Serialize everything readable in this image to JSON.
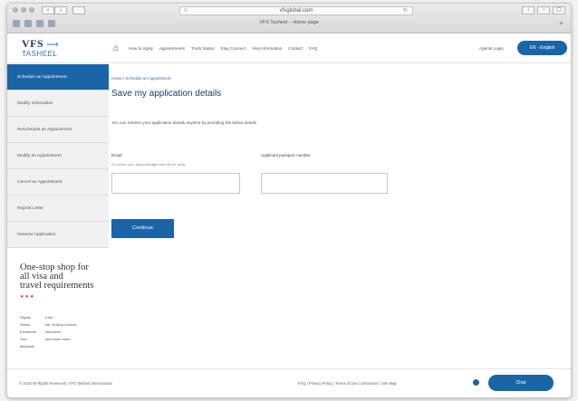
{
  "browser": {
    "url": "vfsglobal.com",
    "tab_title": "VFS Tasheel – Home page",
    "back_icon": "chevron-left-icon",
    "forward_icon": "chevron-right-icon"
  },
  "header": {
    "logo_vfs": "VFS",
    "logo_tasheel": "TASHEEL",
    "nav": [
      "How to Apply",
      "Appointments",
      "Track Status",
      "Stay Connect",
      "Visa Information",
      "Contact",
      "FAQ"
    ],
    "signin": "Agents Login",
    "language_button": "EN - English"
  },
  "sidebar": {
    "items": [
      {
        "label": "Schedule an Appointment",
        "active": true
      },
      {
        "label": "Modify Information",
        "active": false
      },
      {
        "label": "Reschedule an Appointment",
        "active": false
      },
      {
        "label": "Modify an Appointment",
        "active": false
      },
      {
        "label": "Cancel an Appointment",
        "active": false
      },
      {
        "label": "Reprint Letter",
        "active": false
      },
      {
        "label": "Resume Application",
        "active": false
      }
    ],
    "promo": {
      "slogan_lines": [
        "One-stop shop for",
        "all visa and",
        "travel requirements"
      ],
      "col1": [
        "Flights",
        "Hotels",
        "Residents",
        "Tour",
        "Medicals"
      ],
      "col2": [
        "Cars",
        "Intl. Driving Licence",
        "Insurance",
        "and much more"
      ]
    }
  },
  "main": {
    "breadcrumb": "Home / Schedule an Appointment",
    "title": "Save my application details",
    "intro": "You can retrieve your application details anytime by providing the below details",
    "email_label": "Email",
    "email_hint": "(To which your acknowledgement will be sent)",
    "email_value": "",
    "passport_label": "Applicant passport number",
    "passport_value": "",
    "continue_label": "Continue"
  },
  "footer": {
    "copyright": "© 2018 All Rights Reserved | VFS Tasheel International",
    "links": "FAQ  |  Privacy Policy  |  Terms of Use  |  Disclaimer  |  Site Map",
    "chat_label": "Chat"
  },
  "colors": {
    "brand_blue": "#1a65a8",
    "navy": "#1c3a6b"
  }
}
